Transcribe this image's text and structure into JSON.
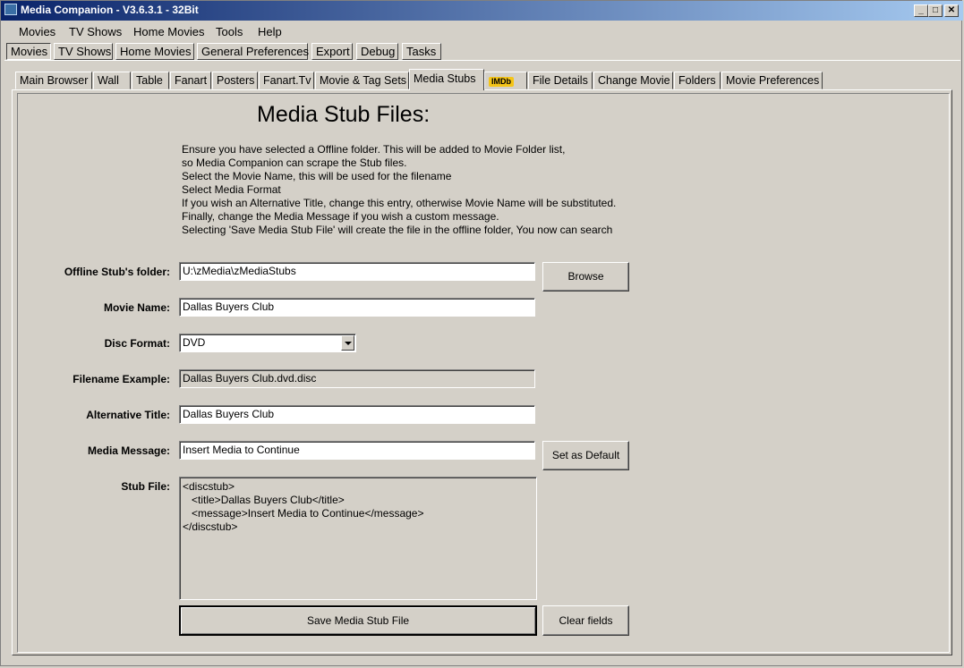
{
  "window": {
    "title": "Media Companion - V3.6.3.1 - 32Bit"
  },
  "menu": [
    "Movies",
    "TV Shows",
    "Home Movies",
    "Tools",
    "Help"
  ],
  "top_tabs": [
    "Movies",
    "TV Shows",
    "Home Movies",
    "General Preferences",
    "Export",
    "Debug",
    "Tasks"
  ],
  "inner_tabs": [
    "Main Browser",
    "Wall",
    "Table",
    "Fanart",
    "Posters",
    "Fanart.Tv",
    "Movie & Tag Sets",
    "Media Stubs",
    "IMDb",
    "File Details",
    "Change Movie",
    "Folders",
    "Movie Preferences"
  ],
  "heading": "Media Stub Files:",
  "instructions": [
    "Ensure you have selected a Offline folder.  This will be added to Movie Folder list,",
    "so Media Companion can scrape the Stub files.",
    "Select the Movie Name, this will be used for the filename",
    "Select Media Format",
    "If you wish an Alternative Title, change this entry, otherwise Movie Name will be substituted.",
    "Finally, change the Media Message if you wish a custom message.",
    "Selecting 'Save Media Stub File' will create the file in the offline folder, You now can search"
  ],
  "form": {
    "offline_label": "Offline Stub's folder:",
    "offline_value": "U:\\zMedia\\zMediaStubs",
    "browse": "Browse",
    "movie_label": "Movie Name:",
    "movie_value": "Dallas Buyers Club",
    "disc_label": "Disc Format:",
    "disc_value": "DVD",
    "filename_label": "Filename Example:",
    "filename_value": "Dallas Buyers Club.dvd.disc",
    "alt_label": "Alternative Title:",
    "alt_value": "Dallas Buyers Club",
    "message_label": "Media Message:",
    "message_value": "Insert Media to Continue",
    "set_default": "Set as Default",
    "stub_label": "Stub File:",
    "stub_value": "<discstub>\n   <title>Dallas Buyers Club</title>\n   <message>Insert Media to Continue</message>\n</discstub>",
    "save": "Save Media Stub File",
    "clear": "Clear fields"
  },
  "colors": {
    "titlebar_start": "#0a246a",
    "titlebar_end": "#a6caf0",
    "imdb_badge": "#f5c518"
  }
}
